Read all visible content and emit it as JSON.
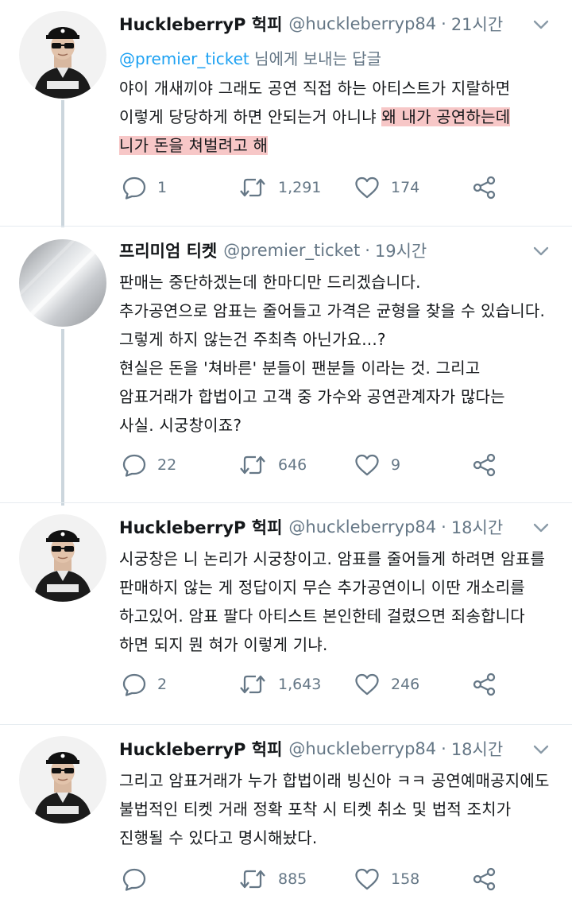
{
  "tweets": [
    {
      "name": "HuckleberryP 헉피",
      "handle": "@huckleberryp84",
      "time": "21시간",
      "reply_to_mention": "@premier_ticket",
      "reply_to_suffix": " 님에게 보내는 답글",
      "lines": [
        "야이 개새끼야 그래도 공연 직접 하는 아티스트가 지랄하면",
        "이렇게 당당하게 하면 안되는거 아니냐 "
      ],
      "highlight_inline": "왜 내가 공연하는데",
      "highlight_line": "니가 돈을 쳐벌려고 해",
      "replies": "1",
      "retweets": "1,291",
      "likes": "174"
    },
    {
      "name": "프리미엄 티켓",
      "handle": "@premier_ticket",
      "time": "19시간",
      "lines": [
        "판매는 중단하겠는데 한마디만 드리겠습니다.",
        "추가공연으로 암표는 줄어들고 가격은 균형을 찾을 수 있습니다.",
        "그렇게 하지 않는건 주최측 아닌가요...?",
        "현실은 돈을 '쳐바른' 분들이 팬분들 이라는 것. 그리고",
        "암표거래가 합법이고 고객 중 가수와 공연관계자가 많다는",
        "사실. 시궁창이죠?"
      ],
      "replies": "22",
      "retweets": "646",
      "likes": "9"
    },
    {
      "name": "HuckleberryP 헉피",
      "handle": "@huckleberryp84",
      "time": "18시간",
      "lines": [
        "시궁창은 니 논리가 시궁창이고. 암표를 줄어들게 하려면 암표를",
        "판매하지 않는 게 정답이지 무슨 추가공연이니 이딴 개소리를",
        "하고있어. 암표 팔다 아티스트 본인한테 걸렸으면 죄송합니다",
        "하면 되지 뭔 혀가 이렇게 기냐."
      ],
      "replies": "2",
      "retweets": "1,643",
      "likes": "246"
    },
    {
      "name": "HuckleberryP 헉피",
      "handle": "@huckleberryp84",
      "time": "18시간",
      "lines": [
        "그리고 암표거래가 누가 합법이래 빙신아 ㅋㅋ 공연예매공지에도",
        "불법적인 티켓 거래 정확 포착 시 티켓 취소 및 법적 조치가",
        "진행될 수 있다고 명시해놨다."
      ],
      "replies": "",
      "retweets": "885",
      "likes": "158"
    }
  ],
  "colors": {
    "text": "#14171a",
    "muted": "#657786",
    "link": "#1da1f2",
    "thread": "#ccd6dd",
    "highlight": "#f7c7c7"
  },
  "icons": [
    "reply-icon",
    "retweet-icon",
    "like-icon",
    "share-icon",
    "chevron-down-icon"
  ]
}
